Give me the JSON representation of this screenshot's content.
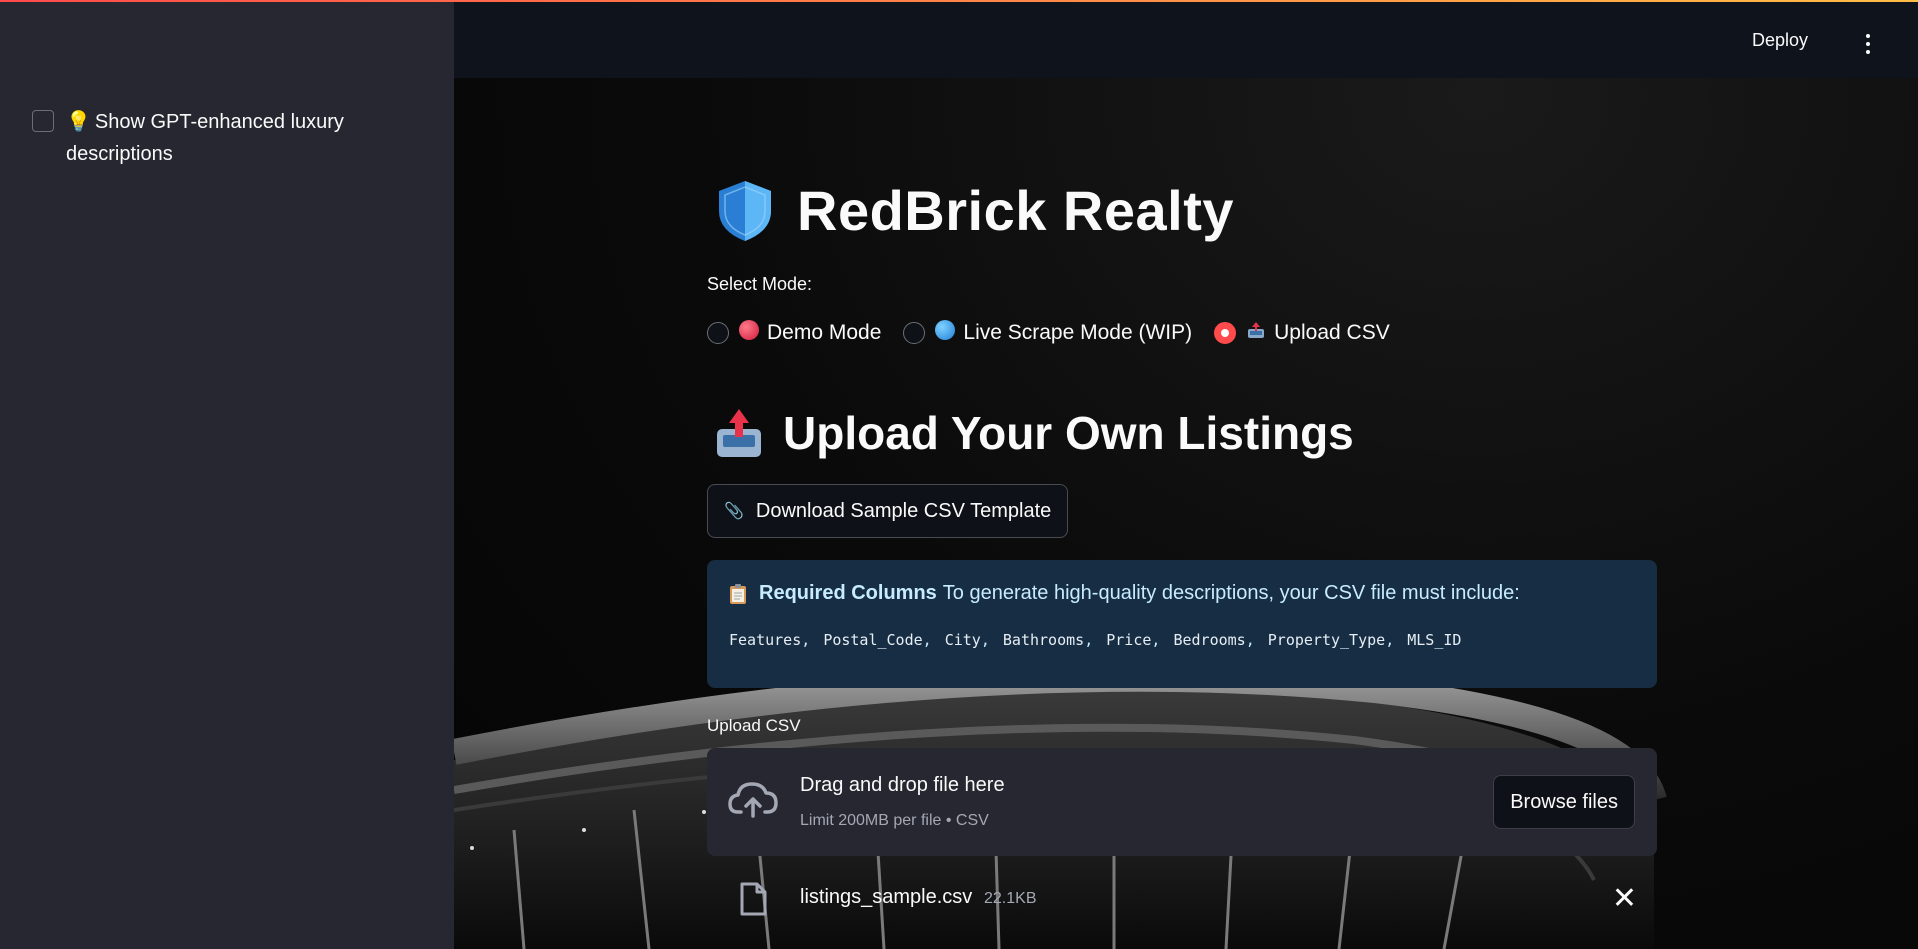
{
  "sidebar": {
    "checkbox_label": "Show GPT-enhanced luxury descriptions",
    "checkbox_checked": false,
    "checkbox_icon": "lightbulb-icon"
  },
  "header": {
    "deploy_label": "Deploy",
    "menu_icon": "kebab-menu-icon"
  },
  "main": {
    "title": "RedBrick Realty",
    "title_icon": "shield-icon",
    "mode_label": "Select Mode:",
    "modes": [
      {
        "label": "Demo Mode",
        "icon": "red-circle-icon",
        "selected": false
      },
      {
        "label": "Live Scrape Mode (WIP)",
        "icon": "globe-icon",
        "selected": false
      },
      {
        "label": "Upload CSV",
        "icon": "outbox-tray-icon",
        "selected": true
      }
    ],
    "section_title": "Upload Your Own Listings",
    "section_icon": "outbox-tray-icon",
    "download_button": "Download Sample CSV Template",
    "download_icon": "paperclip-icon",
    "info": {
      "icon": "clipboard-icon",
      "strong": "Required Columns",
      "text": "To generate high-quality descriptions, your CSV file must include:",
      "columns": [
        "Features",
        "Postal_Code",
        "City",
        "Bathrooms",
        "Price",
        "Bedrooms",
        "Property_Type",
        "MLS_ID"
      ]
    },
    "upload_label": "Upload CSV",
    "dropzone": {
      "title": "Drag and drop file here",
      "subtitle": "Limit 200MB per file • CSV",
      "browse_label": "Browse files",
      "icon": "cloud-upload-icon"
    },
    "file": {
      "name": "listings_sample.csv",
      "size": "22.1KB",
      "icon": "file-icon",
      "remove_icon": "close-icon"
    }
  },
  "colors": {
    "sidebar_bg": "#262730",
    "main_bg": "#0e1117",
    "accent": "#ff4b4b",
    "info_bg": "#172d43",
    "info_text": "#c7ebff"
  }
}
